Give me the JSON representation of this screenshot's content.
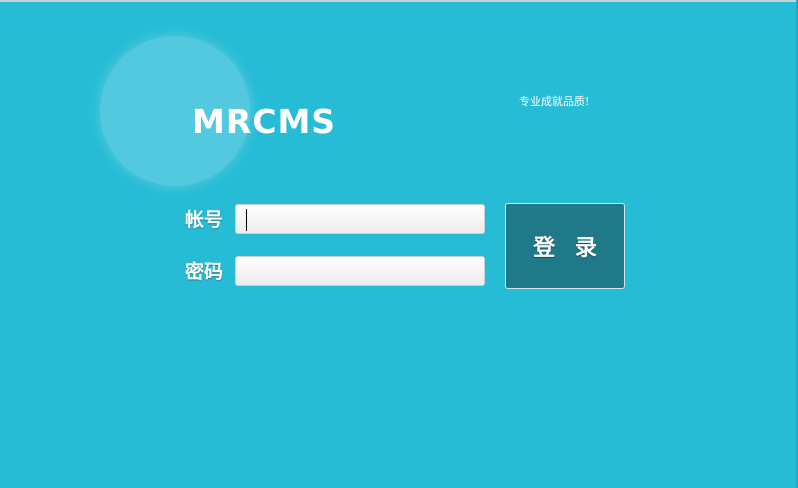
{
  "brand": {
    "logo_text": "MRCMS",
    "slogan": "专业成就品质!"
  },
  "login_form": {
    "account_label": "帐号",
    "account_value": "",
    "password_label": "密码",
    "password_value": "",
    "submit_label": "登 录"
  },
  "colors": {
    "background": "#27bcd6",
    "button": "#1f7989",
    "text": "#ffffff"
  }
}
